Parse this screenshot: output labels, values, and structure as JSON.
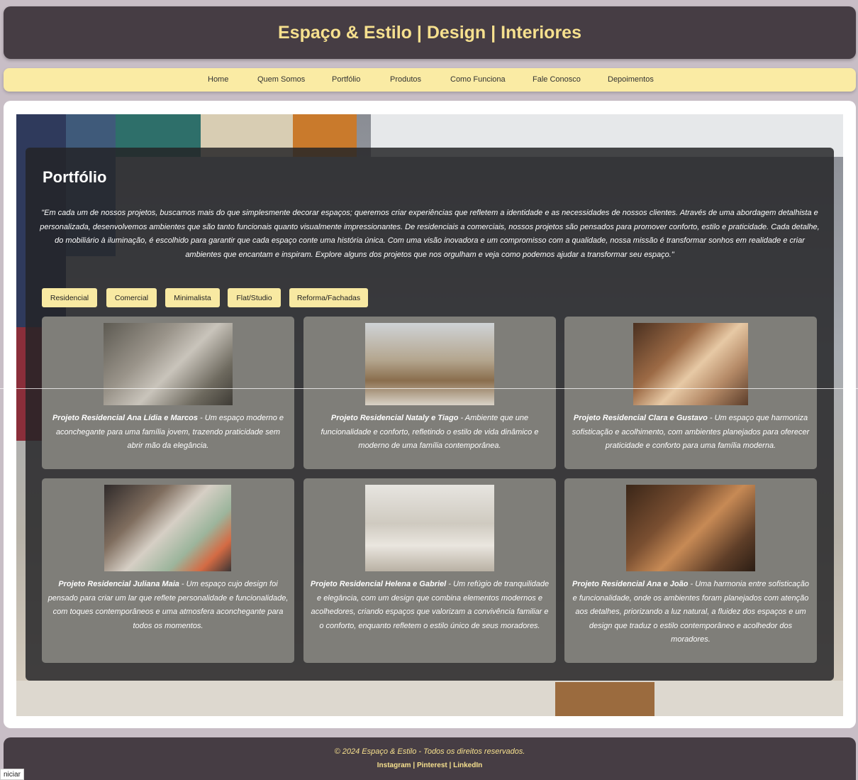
{
  "header": {
    "title": "Espaço & Estilo | Design | Interiores"
  },
  "nav": {
    "items": [
      {
        "label": "Home"
      },
      {
        "label": "Quem Somos"
      },
      {
        "label": "Portfólio"
      },
      {
        "label": "Produtos"
      },
      {
        "label": "Como Funciona"
      },
      {
        "label": "Fale Conosco"
      },
      {
        "label": "Depoimentos"
      }
    ]
  },
  "portfolio": {
    "title": "Portfólio",
    "intro": "\"Em cada um de nossos projetos, buscamos mais do que simplesmente decorar espaços; queremos criar experiências que refletem a identidade e as necessidades de nossos clientes. Através de uma abordagem detalhista e personalizada, desenvolvemos ambientes que são tanto funcionais quanto visualmente impressionantes. De residenciais a comerciais, nossos projetos são pensados para promover conforto, estilo e praticidade. Cada detalhe, do mobiliário à iluminação, é escolhido para garantir que cada espaço conte uma história única. Com uma visão inovadora e um compromisso com a qualidade, nossa missão é transformar sonhos em realidade e criar ambientes que encantam e inspiram. Explore alguns dos projetos que nos orgulham e veja como podemos ajudar a transformar seu espaço.\"",
    "filters": [
      "Residencial",
      "Comercial",
      "Minimalista",
      "Flat/Studio",
      "Reforma/Fachadas"
    ],
    "projects": [
      {
        "name": "Projeto Residencial Ana Lídia e Marcos",
        "desc": " - Um espaço moderno e aconchegante para uma família jovem, trazendo praticidade sem abrir mão da elegância."
      },
      {
        "name": "Projeto Residencial Nataly e Tiago",
        "desc": " - Ambiente que une funcionalidade e conforto, refletindo o estilo de vida dinâmico e moderno de uma família contemporânea."
      },
      {
        "name": "Projeto Residencial Clara e Gustavo",
        "desc": " - Um espaço que harmoniza sofisticação e acolhimento, com ambientes planejados para oferecer praticidade e conforto para uma família moderna."
      },
      {
        "name": "Projeto Residencial Juliana Maia",
        "desc": " - Um espaço cujo design foi pensado para criar um lar que reflete personalidade e funcionalidade, com toques contemporâneos e uma atmosfera aconchegante para todos os momentos."
      },
      {
        "name": "Projeto Residencial Helena e Gabriel",
        "desc": " - Um refúgio de tranquilidade e elegância, com um design que combina elementos modernos e acolhedores, criando espaços que valorizam a convivência familiar e o conforto, enquanto refletem o estilo único de seus moradores."
      },
      {
        "name": "Projeto Residencial Ana e João",
        "desc": " - Uma harmonia entre sofisticação e funcionalidade, onde os ambientes foram planejados com atenção aos detalhes, priorizando a luz natural, a fluidez dos espaços e um design que traduz o estilo contemporâneo e acolhedor dos moradores."
      }
    ]
  },
  "footer": {
    "copyright": "© 2024 Espaço & Estilo - Todos os direitos reservados.",
    "links": [
      "Instagram",
      "Pinterest",
      "LinkedIn"
    ]
  },
  "status_bar": {
    "text": "niciar"
  },
  "colors": {
    "dark": "#463d44",
    "accent": "#f6e08e",
    "nav_bg": "#faeba4",
    "card_bg": "#7f7e79"
  }
}
